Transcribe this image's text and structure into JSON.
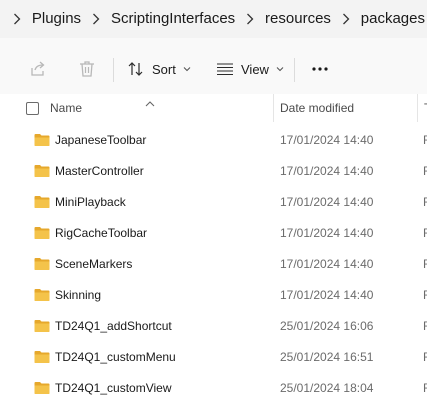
{
  "breadcrumb": {
    "items": [
      "Plugins",
      "ScriptingInterfaces",
      "resources",
      "packages"
    ]
  },
  "toolbar": {
    "sort_label": "Sort",
    "view_label": "View",
    "more_label": "..."
  },
  "header": {
    "name": "Name",
    "date_modified": "Date modified",
    "type": "T"
  },
  "files": [
    {
      "name": "JapaneseToolbar",
      "date": "17/01/2024 14:40",
      "type": "F"
    },
    {
      "name": "MasterController",
      "date": "17/01/2024 14:40",
      "type": "F"
    },
    {
      "name": "MiniPlayback",
      "date": "17/01/2024 14:40",
      "type": "F"
    },
    {
      "name": "RigCacheToolbar",
      "date": "17/01/2024 14:40",
      "type": "F"
    },
    {
      "name": "SceneMarkers",
      "date": "17/01/2024 14:40",
      "type": "F"
    },
    {
      "name": "Skinning",
      "date": "17/01/2024 14:40",
      "type": "F"
    },
    {
      "name": "TD24Q1_addShortcut",
      "date": "25/01/2024 16:06",
      "type": "F"
    },
    {
      "name": "TD24Q1_customMenu",
      "date": "25/01/2024 16:51",
      "type": "F"
    },
    {
      "name": "TD24Q1_customView",
      "date": "25/01/2024 18:04",
      "type": "F"
    }
  ],
  "colors": {
    "folder": "#f4c34a",
    "folder_tab": "#e6a82c"
  }
}
